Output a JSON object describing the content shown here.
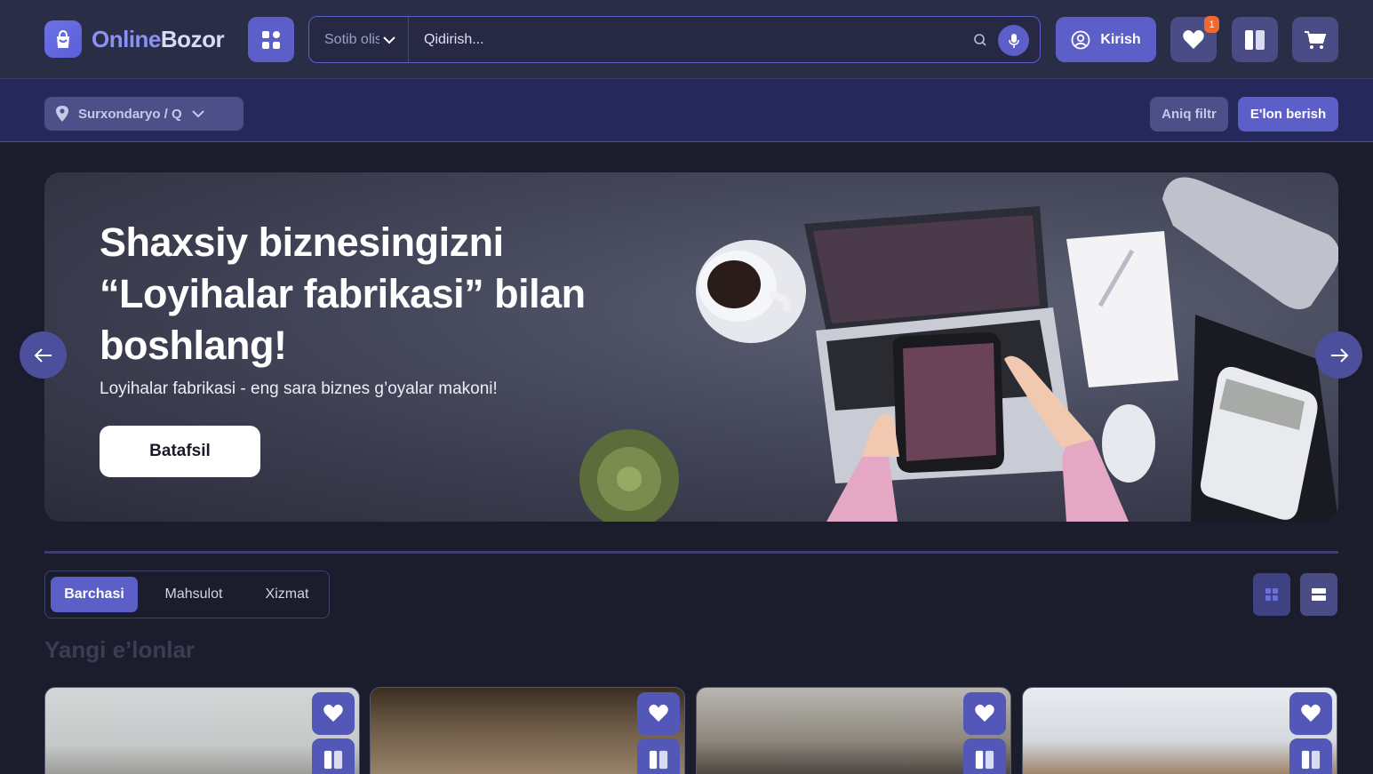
{
  "header": {
    "logo": {
      "part1": "Online",
      "part2": "Bozor"
    },
    "search": {
      "category_selected": "Sotib olish",
      "placeholder": "Qidirish..."
    },
    "login_label": "Kirish",
    "favorites_count": "1"
  },
  "subbar": {
    "location": "Surxondaryo / Qiziriq",
    "filter_label": "Aniq filtr",
    "post_label": "E'lon berish"
  },
  "banner": {
    "title": "Shaxsiy biznesingizni “Loyihalar fabrikasi” bilan boshlang!",
    "subtitle": "Loyihalar fabrikasi - eng sara biznes g’oyalar makoni!",
    "button_label": "Batafsil"
  },
  "tabs": [
    {
      "label": "Barchasi",
      "active": true
    },
    {
      "label": "Mahsulot",
      "active": false
    },
    {
      "label": "Xizmat",
      "active": false
    }
  ],
  "section_title": "Yangi e’lonlar",
  "colors": {
    "accent": "#5b5fc7",
    "background": "#1b1d2d",
    "header": "#2a2d46",
    "badge": "#f06a30"
  },
  "icons": [
    "shopping-bag-icon",
    "grid-icon",
    "chevron-down-icon",
    "search-icon",
    "mic-icon",
    "user-icon",
    "heart-icon",
    "compare-icon",
    "cart-icon",
    "location-pin-icon",
    "arrow-left-icon",
    "arrow-right-icon",
    "list-view-icon",
    "grid-view-icon"
  ]
}
